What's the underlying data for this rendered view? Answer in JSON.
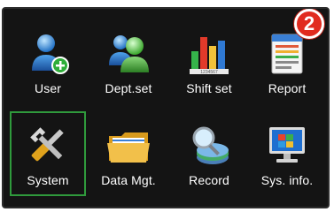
{
  "menu": {
    "items": [
      {
        "label": "User",
        "icon": "user-add-icon"
      },
      {
        "label": "Dept.set",
        "icon": "department-icon"
      },
      {
        "label": "Shift set",
        "icon": "shift-chart-icon"
      },
      {
        "label": "Report",
        "icon": "report-icon"
      },
      {
        "label": "System",
        "icon": "wrench-screwdriver-icon",
        "selected": true
      },
      {
        "label": "Data Mgt.",
        "icon": "folder-icon"
      },
      {
        "label": "Record",
        "icon": "search-record-icon"
      },
      {
        "label": "Sys. info.",
        "icon": "computer-icon"
      }
    ]
  },
  "badge": {
    "number": "2"
  },
  "colors": {
    "background": "#141414",
    "selected_border": "#2f9a3c",
    "badge": "#e12b1f"
  }
}
